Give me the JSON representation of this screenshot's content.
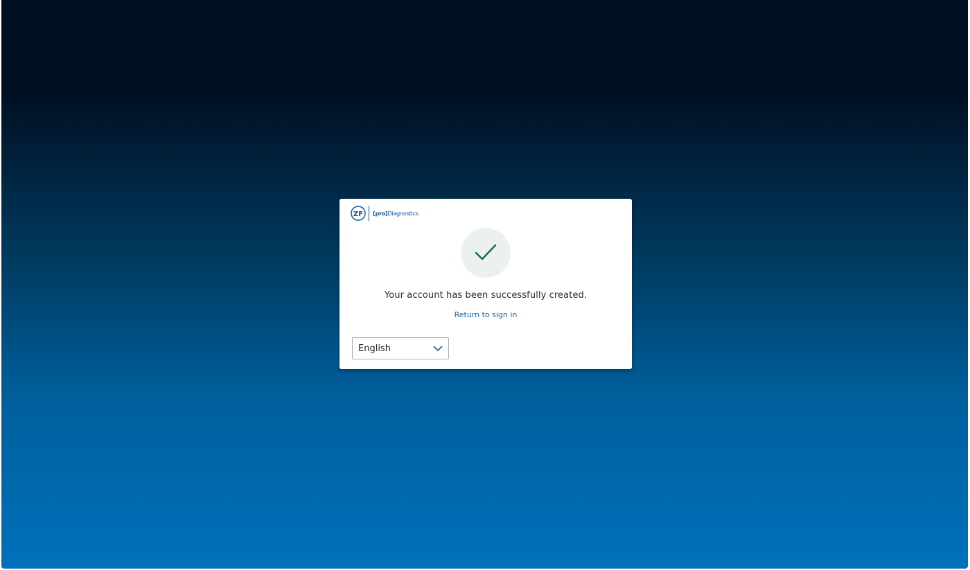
{
  "brand": {
    "logo_mark": "ZF",
    "product_prefix": "[pro]",
    "product_name": "Diagnostics",
    "color": "#0a4f9b"
  },
  "status": {
    "icon": "check-icon",
    "icon_color": "#1a6b3a",
    "circle_color": "#eaf1ee",
    "message": "Your account has been successfully created."
  },
  "actions": {
    "return_link": "Return to sign in",
    "link_color": "#1565a6"
  },
  "language": {
    "selected": "English"
  }
}
